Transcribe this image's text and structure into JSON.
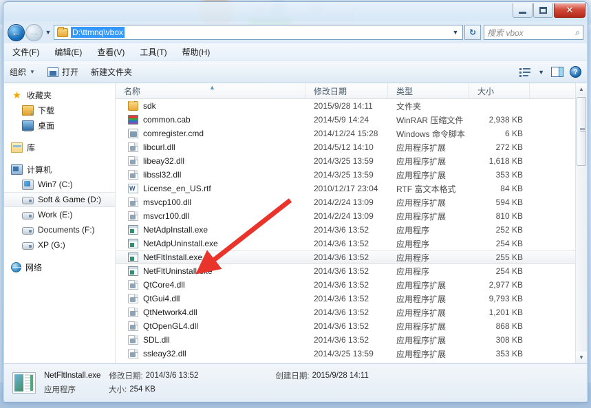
{
  "window": {
    "controls": {
      "minimize": "—",
      "maximize": "□",
      "close": "✕"
    }
  },
  "address": {
    "path_value": "D:\\ttmnq\\vbox",
    "back_glyph": "←",
    "forward_glyph": "→",
    "history_caret": "▼",
    "path_caret": "▼",
    "refresh_glyph": "↻",
    "search_placeholder": "搜索 vbox",
    "search_icon": "⌕"
  },
  "menubar": {
    "items": [
      {
        "label": "文件(F)"
      },
      {
        "label": "编辑(E)"
      },
      {
        "label": "查看(V)"
      },
      {
        "label": "工具(T)"
      },
      {
        "label": "帮助(H)"
      }
    ]
  },
  "commandbar": {
    "organize": "组织",
    "organize_caret": "▼",
    "open": "打开",
    "new_folder": "新建文件夹",
    "view_caret": "▼",
    "help_glyph": "?"
  },
  "navpane": {
    "items": [
      {
        "label": "收藏夹",
        "icon": "star-icon",
        "level": 1
      },
      {
        "label": "下载",
        "icon": "download-folder-icon",
        "level": 2
      },
      {
        "label": "桌面",
        "icon": "desktop-icon",
        "level": 2
      },
      {
        "label": "库",
        "icon": "library-icon",
        "level": 1
      },
      {
        "label": "计算机",
        "icon": "computer-icon",
        "level": 1
      },
      {
        "label": "Win7 (C:)",
        "icon": "system-drive-icon",
        "level": 2
      },
      {
        "label": "Soft & Game (D:)",
        "icon": "drive-icon",
        "level": 2,
        "selected": true
      },
      {
        "label": "Work (E:)",
        "icon": "drive-icon",
        "level": 2
      },
      {
        "label": "Documents (F:)",
        "icon": "drive-icon",
        "level": 2
      },
      {
        "label": "XP (G:)",
        "icon": "drive-icon",
        "level": 2
      },
      {
        "label": "网络",
        "icon": "network-icon",
        "level": 1
      }
    ]
  },
  "filelist": {
    "columns": [
      {
        "key": "name",
        "label": "名称"
      },
      {
        "key": "date",
        "label": "修改日期"
      },
      {
        "key": "type",
        "label": "类型"
      },
      {
        "key": "size",
        "label": "大小"
      }
    ],
    "sort_arrow": "▲",
    "rows": [
      {
        "name": "sdk",
        "date": "2015/9/28 14:11",
        "type": "文件夹",
        "size": "",
        "icon": "folder-icon"
      },
      {
        "name": "common.cab",
        "date": "2014/5/9 14:24",
        "type": "WinRAR 压缩文件",
        "size": "2,938 KB",
        "icon": "winrar-archive-icon"
      },
      {
        "name": "comregister.cmd",
        "date": "2014/12/24 15:28",
        "type": "Windows 命令脚本",
        "size": "6 KB",
        "icon": "cmd-script-icon"
      },
      {
        "name": "libcurl.dll",
        "date": "2014/5/12 14:10",
        "type": "应用程序扩展",
        "size": "272 KB",
        "icon": "dll-icon"
      },
      {
        "name": "libeay32.dll",
        "date": "2014/3/25 13:59",
        "type": "应用程序扩展",
        "size": "1,618 KB",
        "icon": "dll-icon"
      },
      {
        "name": "libssl32.dll",
        "date": "2014/3/25 13:59",
        "type": "应用程序扩展",
        "size": "353 KB",
        "icon": "dll-icon"
      },
      {
        "name": "License_en_US.rtf",
        "date": "2010/12/17 23:04",
        "type": "RTF 富文本格式",
        "size": "84 KB",
        "icon": "rtf-document-icon"
      },
      {
        "name": "msvcp100.dll",
        "date": "2014/2/24 13:09",
        "type": "应用程序扩展",
        "size": "594 KB",
        "icon": "dll-icon"
      },
      {
        "name": "msvcr100.dll",
        "date": "2014/2/24 13:09",
        "type": "应用程序扩展",
        "size": "810 KB",
        "icon": "dll-icon"
      },
      {
        "name": "NetAdpInstall.exe",
        "date": "2014/3/6 13:52",
        "type": "应用程序",
        "size": "252 KB",
        "icon": "application-icon"
      },
      {
        "name": "NetAdpUninstall.exe",
        "date": "2014/3/6 13:52",
        "type": "应用程序",
        "size": "254 KB",
        "icon": "application-icon"
      },
      {
        "name": "NetFltInstall.exe",
        "date": "2014/3/6 13:52",
        "type": "应用程序",
        "size": "255 KB",
        "icon": "application-icon",
        "selected": true
      },
      {
        "name": "NetFltUninstall.exe",
        "date": "2014/3/6 13:52",
        "type": "应用程序",
        "size": "254 KB",
        "icon": "application-icon"
      },
      {
        "name": "QtCore4.dll",
        "date": "2014/3/6 13:52",
        "type": "应用程序扩展",
        "size": "2,977 KB",
        "icon": "dll-icon"
      },
      {
        "name": "QtGui4.dll",
        "date": "2014/3/6 13:52",
        "type": "应用程序扩展",
        "size": "9,793 KB",
        "icon": "dll-icon"
      },
      {
        "name": "QtNetwork4.dll",
        "date": "2014/3/6 13:52",
        "type": "应用程序扩展",
        "size": "1,201 KB",
        "icon": "dll-icon"
      },
      {
        "name": "QtOpenGL4.dll",
        "date": "2014/3/6 13:52",
        "type": "应用程序扩展",
        "size": "868 KB",
        "icon": "dll-icon"
      },
      {
        "name": "SDL.dll",
        "date": "2014/3/6 13:52",
        "type": "应用程序扩展",
        "size": "308 KB",
        "icon": "dll-icon"
      },
      {
        "name": "ssleay32.dll",
        "date": "2014/3/25 13:59",
        "type": "应用程序扩展",
        "size": "353 KB",
        "icon": "dll-icon"
      }
    ]
  },
  "scrollbar": {
    "up_glyph": "▲",
    "down_glyph": "▼"
  },
  "details": {
    "filename": "NetFltInstall.exe",
    "modified_label": "修改日期:",
    "modified_value": "2014/3/6 13:52",
    "created_label": "创建日期:",
    "created_value": "2015/9/28 14:11",
    "type_value": "应用程序",
    "size_label": "大小:",
    "size_value": "254 KB"
  },
  "annotation": {
    "arrow_color": "#e8342a"
  }
}
